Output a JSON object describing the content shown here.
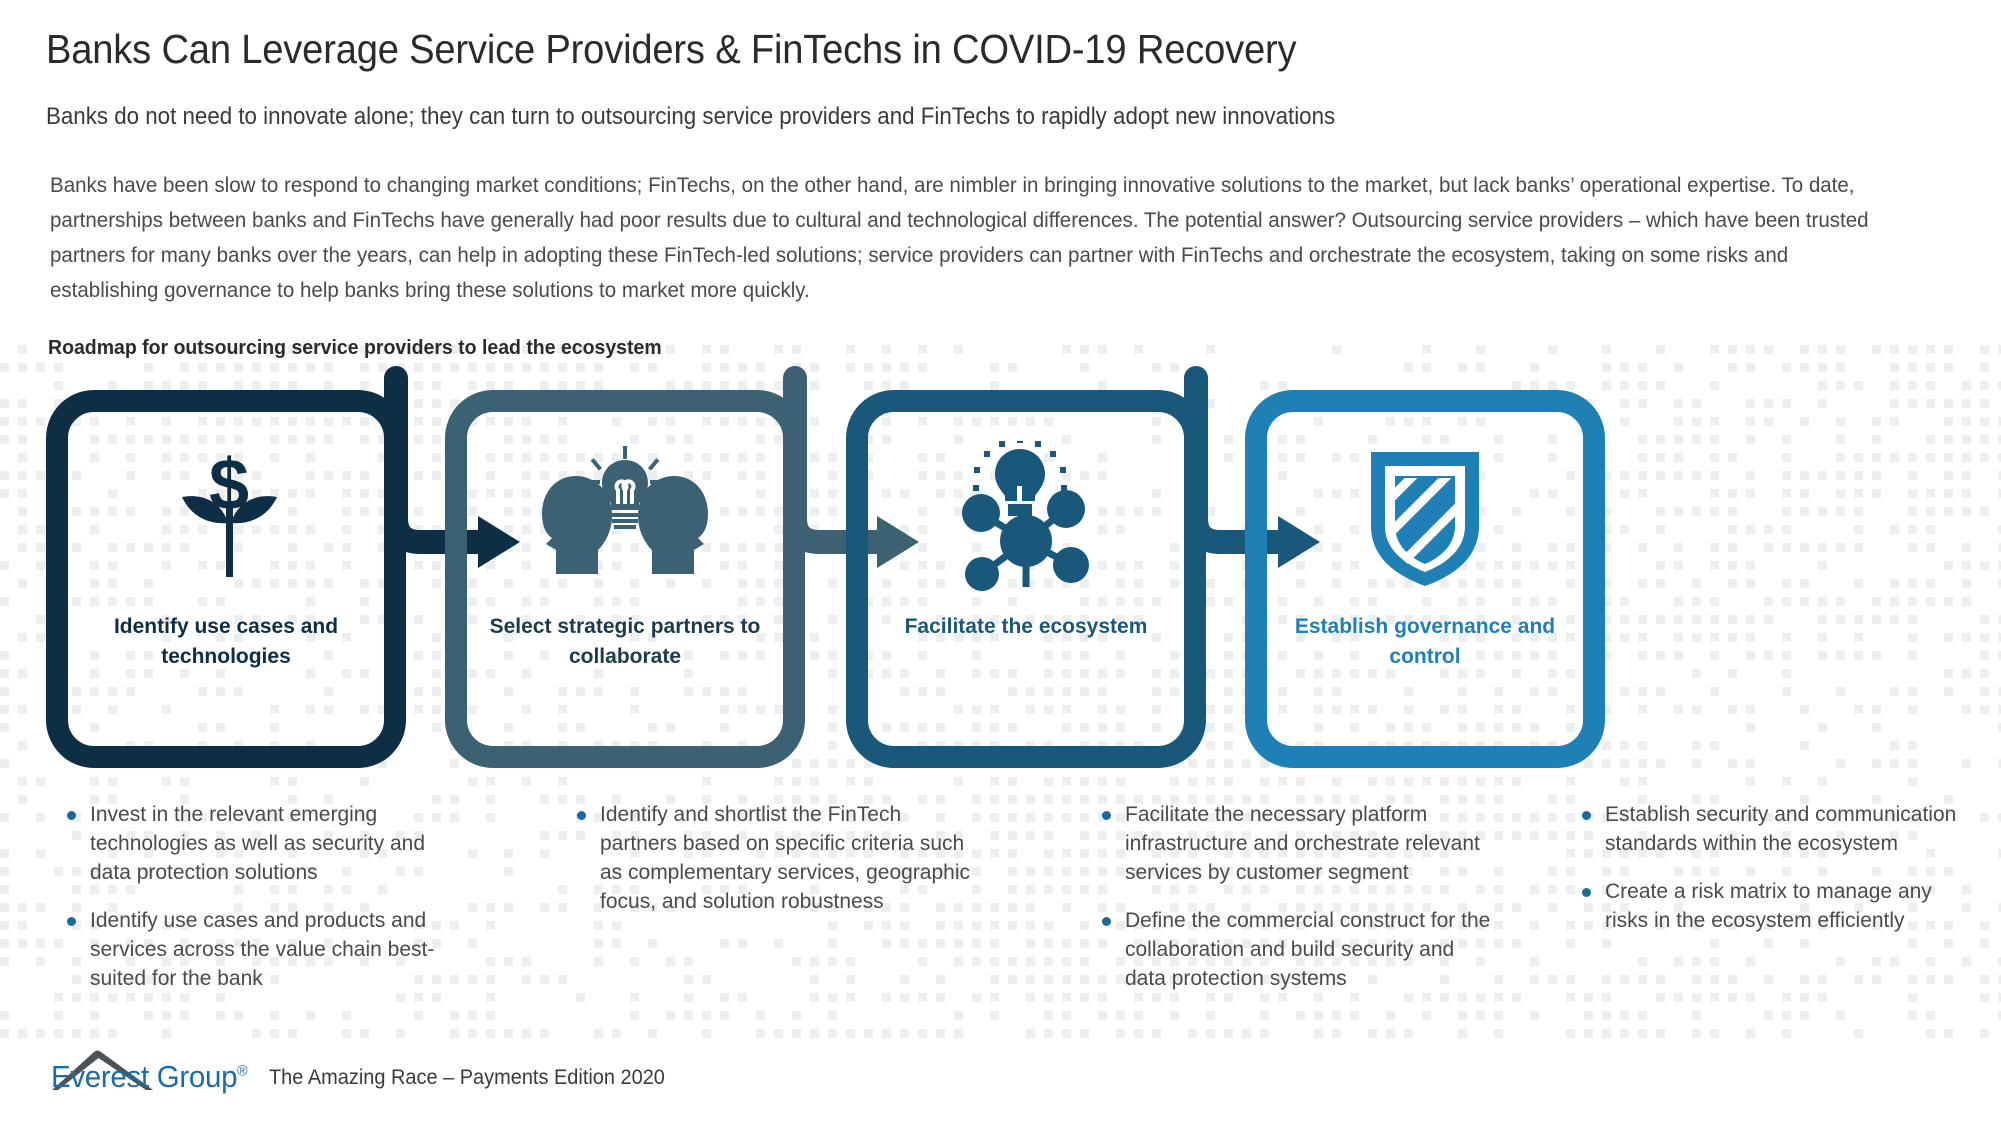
{
  "header": {
    "title": "Banks Can Leverage Service Providers & FinTechs in COVID-19 Recovery",
    "subtitle": "Banks do not need to innovate alone; they can turn to outsourcing service providers and FinTechs to rapidly adopt new innovations",
    "intro_paragraph": "Banks have been slow to respond to changing market conditions; FinTechs, on the other hand, are nimbler in bringing innovative solutions to the market, but lack banks’ operational expertise. To date, partnerships between banks and FinTechs have generally had poor results due to cultural and technological differences. The potential answer? Outsourcing service providers – which have been trusted partners for many banks over the years, can help in adopting these FinTech-led solutions; service providers can partner with FinTechs and orchestrate the ecosystem, taking on some risks and establishing governance to help banks bring these solutions to market more quickly."
  },
  "roadmap": {
    "heading": "Roadmap for outsourcing service providers to lead the ecosystem",
    "stages": [
      {
        "title": "Identify use cases and technologies",
        "icon": "money-plant-icon",
        "color": "#0e2e45",
        "title_color": "#0e2e45",
        "bullets": [
          "Invest in the relevant emerging technologies as well as security and data protection solutions",
          "Identify use cases and products and services across the value chain best-suited for the bank"
        ]
      },
      {
        "title": "Select strategic partners to collaborate",
        "icon": "collaboration-idea-icon",
        "color": "#3c6173",
        "title_color": "#1d3b4b",
        "bullets": [
          "Identify and shortlist the FinTech partners based on specific criteria such as complementary services, geographic focus, and solution robustness"
        ]
      },
      {
        "title": "Facilitate the ecosystem",
        "icon": "network-hub-icon",
        "color": "#19587a",
        "title_color": "#19587a",
        "bullets": [
          "Facilitate the necessary platform infrastructure and orchestrate relevant services by customer segment",
          "Define the commercial construct for the collaboration and build security and data protection systems"
        ]
      },
      {
        "title": "Establish governance and control",
        "icon": "shield-icon",
        "color": "#1f80b5",
        "title_color": "#1f80b5",
        "bullets": [
          "Establish security and communication standards within the ecosystem",
          "Create a risk matrix to manage any risks in the ecosystem efficiently"
        ]
      }
    ],
    "arrow_colors": [
      "#0e2e45",
      "#3c6173",
      "#19587a"
    ]
  },
  "footer": {
    "brand": "Everest Group",
    "brand_mark": "®",
    "caption": "The Amazing Race – Payments Edition 2020",
    "brand_color": "#1b6ca8",
    "peak_color": "#4c5256"
  },
  "colors": {
    "bullet_dot": "#1a6b99",
    "body_text": "#4a4a4a",
    "backdrop_dot": "#eceef0"
  }
}
